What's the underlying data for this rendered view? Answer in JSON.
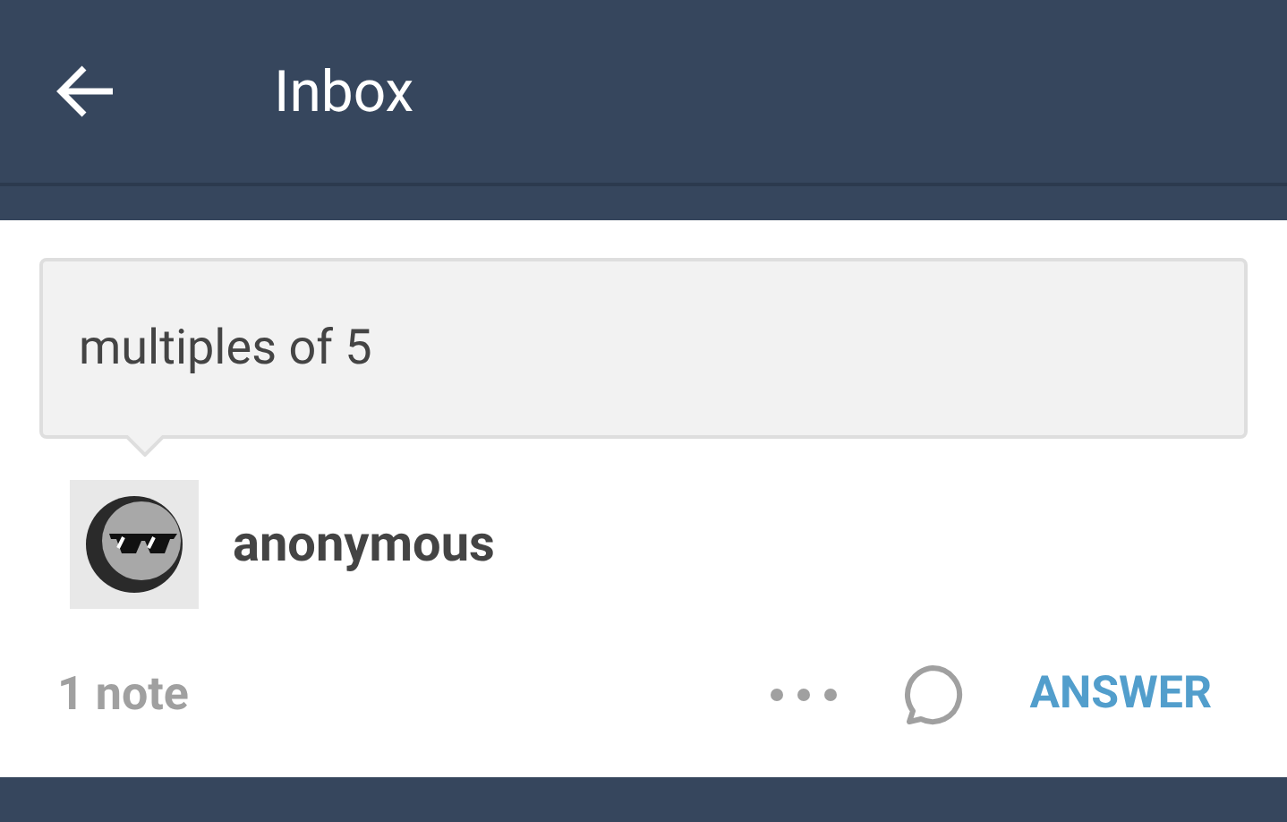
{
  "header": {
    "title": "Inbox"
  },
  "question": {
    "text": "multiples of 5"
  },
  "asker": {
    "name": "anonymous"
  },
  "footer": {
    "notes": "1 note",
    "answer_label": "ANSWER"
  }
}
